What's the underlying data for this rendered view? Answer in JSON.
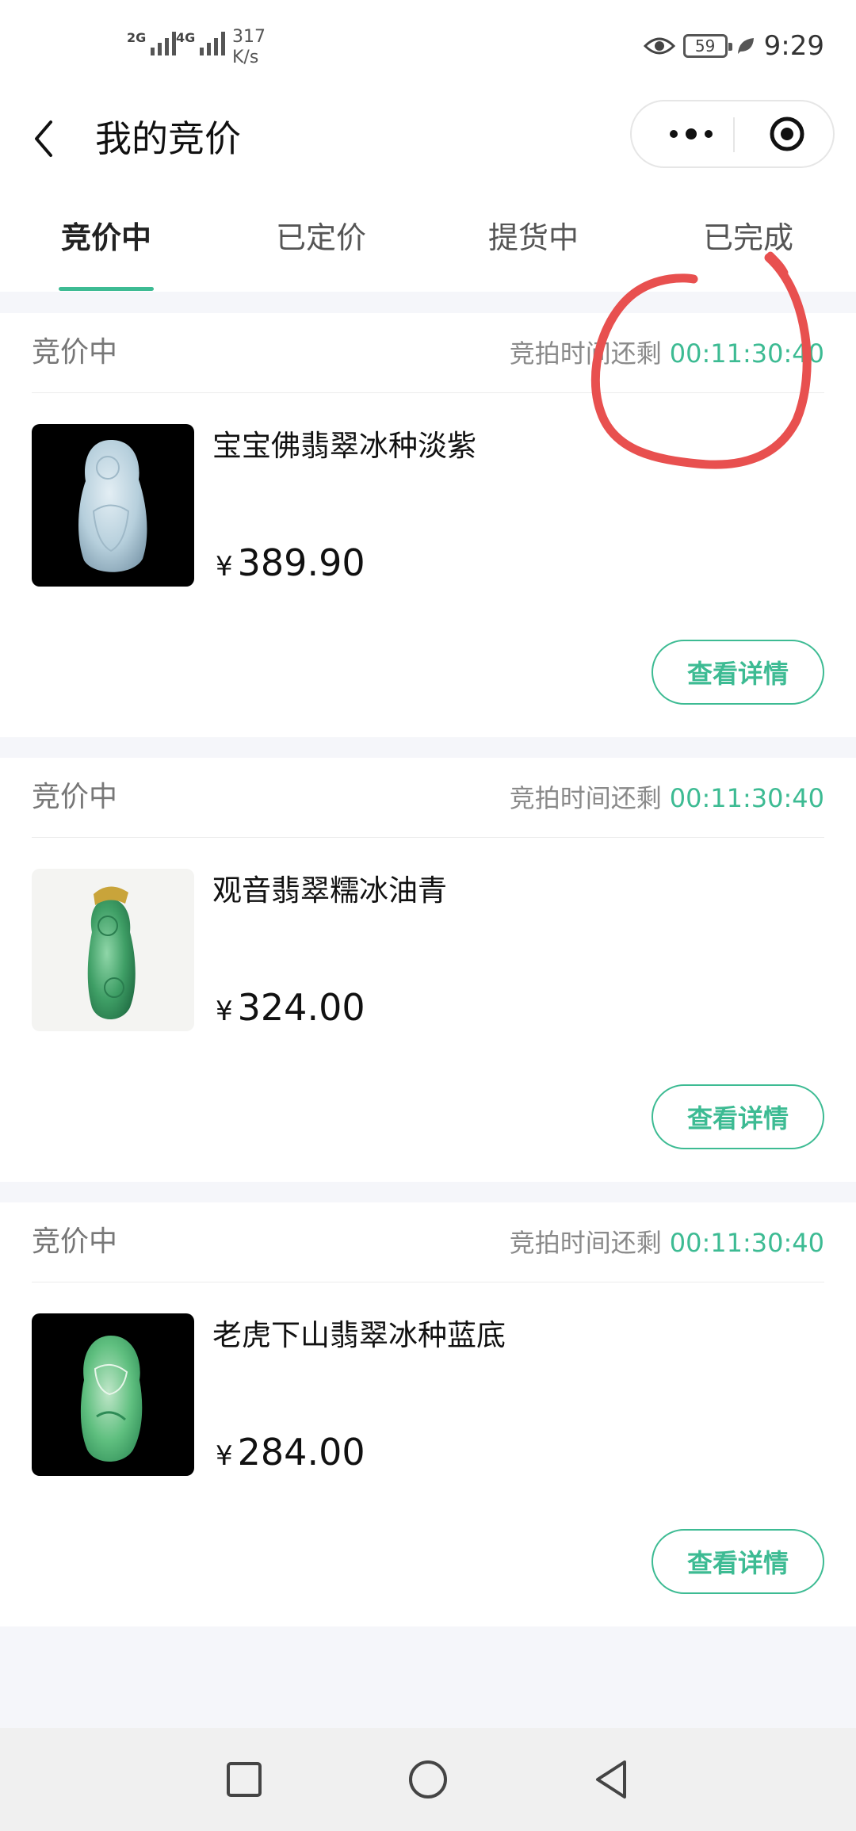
{
  "status_bar": {
    "signal1_label": "2G",
    "signal2_label": "4G",
    "speed_value": "317",
    "speed_unit": "K/s",
    "battery": "59",
    "time": "9:29"
  },
  "nav": {
    "title": "我的竞价"
  },
  "tabs": [
    {
      "label": "竞价中",
      "active": true
    },
    {
      "label": "已定价",
      "active": false
    },
    {
      "label": "提货中",
      "active": false
    },
    {
      "label": "已完成",
      "active": false
    }
  ],
  "cards": [
    {
      "status": "竞价中",
      "countdown_label": "竞拍时间还剩",
      "countdown": "00:11:30:40",
      "name": "宝宝佛翡翠冰种淡紫",
      "currency": "¥",
      "price": "389.90",
      "button": "查看详情"
    },
    {
      "status": "竞价中",
      "countdown_label": "竞拍时间还剩",
      "countdown": "00:11:30:40",
      "name": "观音翡翠糯冰油青",
      "currency": "¥",
      "price": "324.00",
      "button": "查看详情"
    },
    {
      "status": "竞价中",
      "countdown_label": "竞拍时间还剩",
      "countdown": "00:11:30:40",
      "name": "老虎下山翡翠冰种蓝底",
      "currency": "¥",
      "price": "284.00",
      "button": "查看详情"
    }
  ],
  "colors": {
    "accent": "#3dbb93",
    "annotation": "#e8504f"
  },
  "icons": [
    "back-icon",
    "more-icon",
    "target-icon",
    "eye-icon",
    "leaf-icon",
    "square-icon",
    "circle-icon",
    "triangle-back-icon"
  ]
}
